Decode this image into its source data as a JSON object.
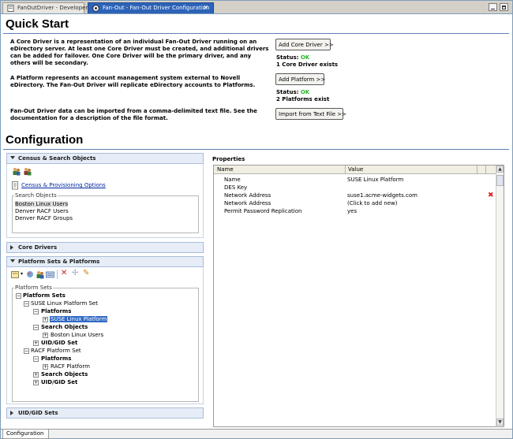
{
  "tabs": [
    {
      "label": "FanOutDriver - Developer",
      "active": false
    },
    {
      "label": "Fan-Out - Fan-Out Driver Configuration",
      "active": true
    }
  ],
  "quick_start": {
    "title": "Quick Start",
    "desc_core": "A Core Driver is a representation of an individual Fan-Out Driver running on an eDirectory server. At least one Core Driver must be created, and additional drivers can be added for failover. One Core Driver will be the primary driver, and any others will be secondary.",
    "desc_platform": "A Platform represents an account management system external to Novell eDirectory. The Fan-Out Driver will replicate eDirectory accounts to Platforms.",
    "desc_import": "Fan-Out Driver data can be imported from a comma-delimited text file. See the documentation for a description of the file format.",
    "add_core_label": "Add Core Driver >>",
    "add_platform_label": "Add Platform >>",
    "import_label": "Import from Text File >>",
    "status_label": "Status:",
    "core_status": "OK",
    "core_count": "1 Core Driver exists",
    "platform_status": "OK",
    "platform_count": "2 Platforms exist"
  },
  "configuration": {
    "title": "Configuration",
    "census": {
      "header": "Census & Search Objects",
      "link": "Census & Provisioning Options",
      "search_group": "Search Objects",
      "search_items": [
        "Boston Linux Users",
        "Denver RACF Users",
        "Denver RACF Groups"
      ],
      "selected_index": 0
    },
    "core_drivers_header": "Core Drivers",
    "platforms": {
      "header": "Platform Sets & Platforms",
      "group": "Platform Sets",
      "tree": {
        "root": "Platform Sets",
        "set1": "SUSE Linux Platform Set",
        "set1_platforms": "Platforms",
        "set1_platform_item": "SUSE Linux Platform",
        "set1_search": "Search Objects",
        "set1_search_item": "Boston Linux Users",
        "set1_uid": "UID/GID Set",
        "set2": "RACF Platform Set",
        "set2_platforms": "Platforms",
        "set2_platform_item": "RACF Platform",
        "set2_search": "Search Objects",
        "set2_uid": "UID/GID Set"
      }
    },
    "uid_header": "UID/GID Sets"
  },
  "properties": {
    "title": "Properties",
    "columns": [
      "Name",
      "Value"
    ],
    "rows": [
      {
        "name": "Name",
        "value": "SUSE Linux Platform"
      },
      {
        "name": "DES Key",
        "value": ""
      },
      {
        "name": "Network Address",
        "value": "suse1.acme-widgets.com"
      },
      {
        "name": "Network Address",
        "value": "(Click to add new)"
      },
      {
        "name": "Permit Password Replication",
        "value": "yes"
      }
    ]
  },
  "bottom_tab": "Configuration",
  "colors": {
    "accent": "#2d63b8",
    "ok": "#27b527",
    "delete": "#e02020",
    "link": "#00269e"
  }
}
